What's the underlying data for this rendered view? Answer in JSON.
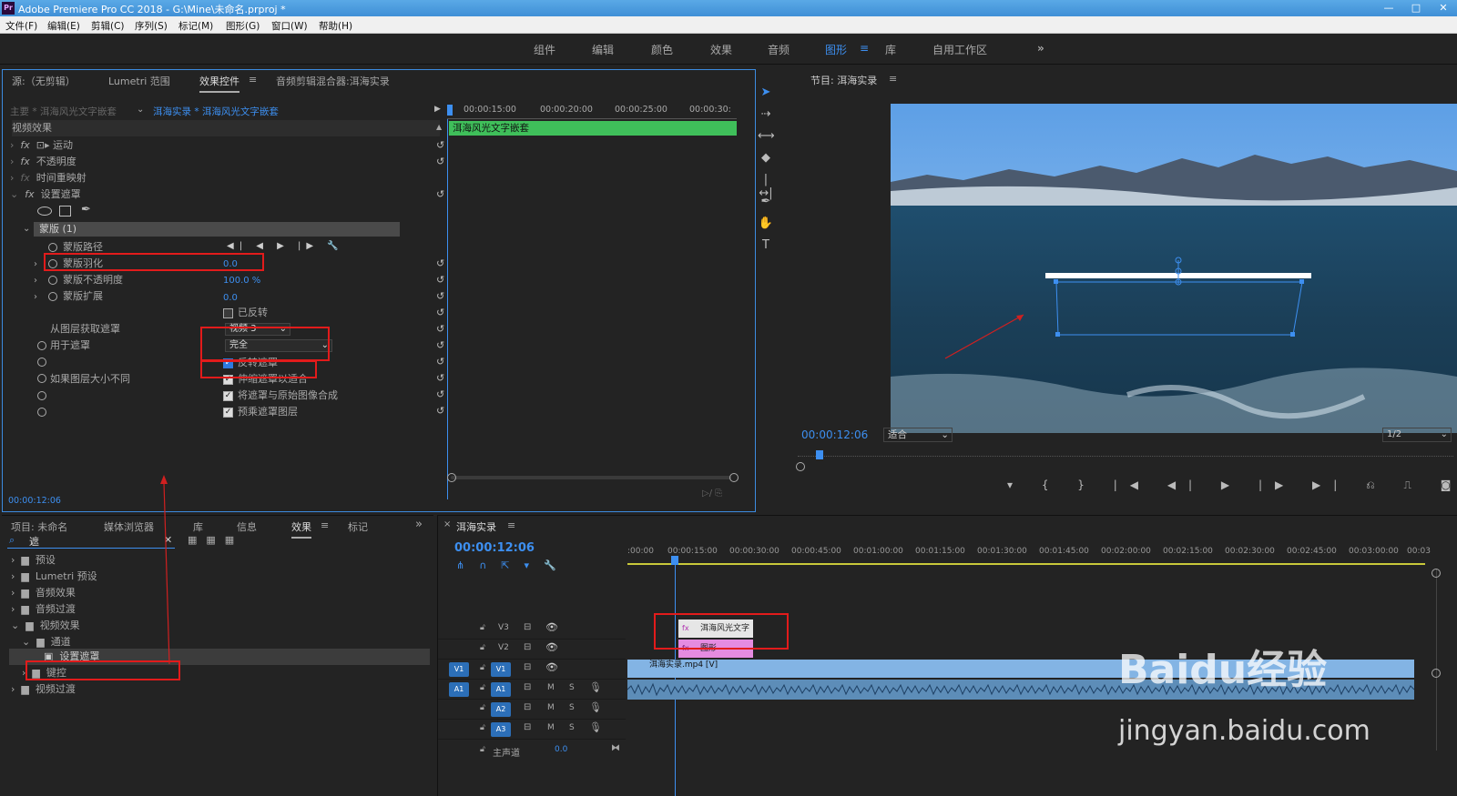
{
  "window": {
    "title": "Adobe Premiere Pro CC 2018 - G:\\Mine\\未命名.prproj *",
    "app_badge": "Pr"
  },
  "menu": [
    "文件(F)",
    "编辑(E)",
    "剪辑(C)",
    "序列(S)",
    "标记(M)",
    "图形(G)",
    "窗口(W)",
    "帮助(H)"
  ],
  "workspaces": [
    "组件",
    "编辑",
    "颜色",
    "效果",
    "音频",
    "图形",
    "库",
    "自用工作区"
  ],
  "workspace_active": "图形",
  "ec": {
    "tabs": [
      "源:（无剪辑）",
      "Lumetri 范围",
      "效果控件",
      "音频剪辑混合器:洱海实录"
    ],
    "master": "主要 * 洱海风光文字嵌套",
    "clip": "洱海实录 * 洱海风光文字嵌套",
    "ruler": [
      "00:00:15:00",
      "00:00:20:00",
      "00:00:25:00",
      "00:00:30:"
    ],
    "clip_bar": "洱海风光文字嵌套",
    "section": "视频效果",
    "effects": [
      "运动",
      "不透明度",
      "时间重映射",
      "设置遮罩"
    ],
    "mask_name": "蒙版 (1)",
    "mask_path": "蒙版路径",
    "feather": {
      "label": "蒙版羽化",
      "value": "0.0"
    },
    "opacity": {
      "label": "蒙版不透明度",
      "value": "100.0 %"
    },
    "expand": {
      "label": "蒙版扩展",
      "value": "0.0"
    },
    "inverted": "已反转",
    "from_layer": {
      "label": "从图层获取遮罩",
      "value": "视频 3"
    },
    "use_for": {
      "label": "用于遮罩",
      "value": "完全"
    },
    "invert_mask": "反转遮罩",
    "if_size": "如果图层大小不同",
    "stretch": "伸缩遮罩以适合",
    "composite": "将遮罩与原始图像合成",
    "premult": "预乘遮罩图层",
    "timecode": "00:00:12:06"
  },
  "program": {
    "title": "节目: 洱海实录",
    "timecode": "00:00:12:06",
    "fit": "适合",
    "quality": "1/2"
  },
  "project": {
    "tabs": [
      "项目: 未命名",
      "媒体浏览器",
      "库",
      "信息",
      "效果",
      "标记"
    ],
    "search": "遮",
    "tree": [
      "预设",
      "Lumetri 预设",
      "音频效果",
      "音频过渡",
      "视频效果",
      "通道",
      "设置遮罩",
      "键控",
      "视频过渡"
    ]
  },
  "timeline": {
    "name": "洱海实录",
    "timecode": "00:00:12:06",
    "ruler": [
      ":00:00",
      "00:00:15:00",
      "00:00:30:00",
      "00:00:45:00",
      "00:01:00:00",
      "00:01:15:00",
      "00:01:30:00",
      "00:01:45:00",
      "00:02:00:00",
      "00:02:15:00",
      "00:02:30:00",
      "00:02:45:00",
      "00:03:00:00",
      "00:03"
    ],
    "tracks": [
      "V3",
      "V2",
      "V1",
      "A1",
      "A2",
      "A3"
    ],
    "master": "主声道",
    "master_val": "0.0",
    "clip_v3": "洱海风光文字",
    "clip_v2": "图形",
    "clip_v1": "洱海实录.mp4 [V]"
  },
  "watermark": {
    "brand": "Baidu经验",
    "url": "jingyan.baidu.com"
  }
}
